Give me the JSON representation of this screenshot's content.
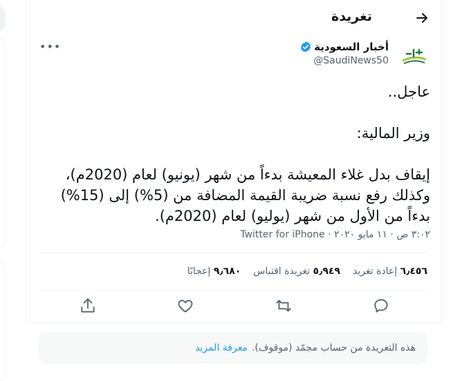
{
  "header": {
    "title": "تغريدة"
  },
  "author": {
    "name": "أخبار السعودية",
    "handle": "@SaudiNews50",
    "avatar_text": "أخبار"
  },
  "tweet": {
    "text": "عاجل..\n\nوزير المالية:\n\nإيقاف بدل غلاء المعيشة بدءاً من شهر (يونيو) لعام (2020م)، وكذلك رفع نسبة ضريبة القيمة المضافة من (5%) إلى (15%) بدءاً من الأول من شهر (يوليو) لعام (2020م).",
    "time": "٣:٠٢ ص",
    "date": "١١ مايو ٢٠٢٠",
    "source": "Twitter for iPhone"
  },
  "stats": {
    "retweets_count": "٦٫٤٥٦",
    "retweets_label": "إعادة تغريد",
    "quotes_count": "٥٫٩٤٩",
    "quotes_label": "تغريدة اقتباس",
    "likes_count": "٩٫٦٨٠",
    "likes_label": "إعجابًا"
  },
  "notice": {
    "text": "هذه التغريدة من حساب مجمّد (موقوف).",
    "link": "معرفة المزيد"
  },
  "colors": {
    "accent": "#1d9bf0",
    "muted": "#536471",
    "border": "#eff3f4"
  }
}
